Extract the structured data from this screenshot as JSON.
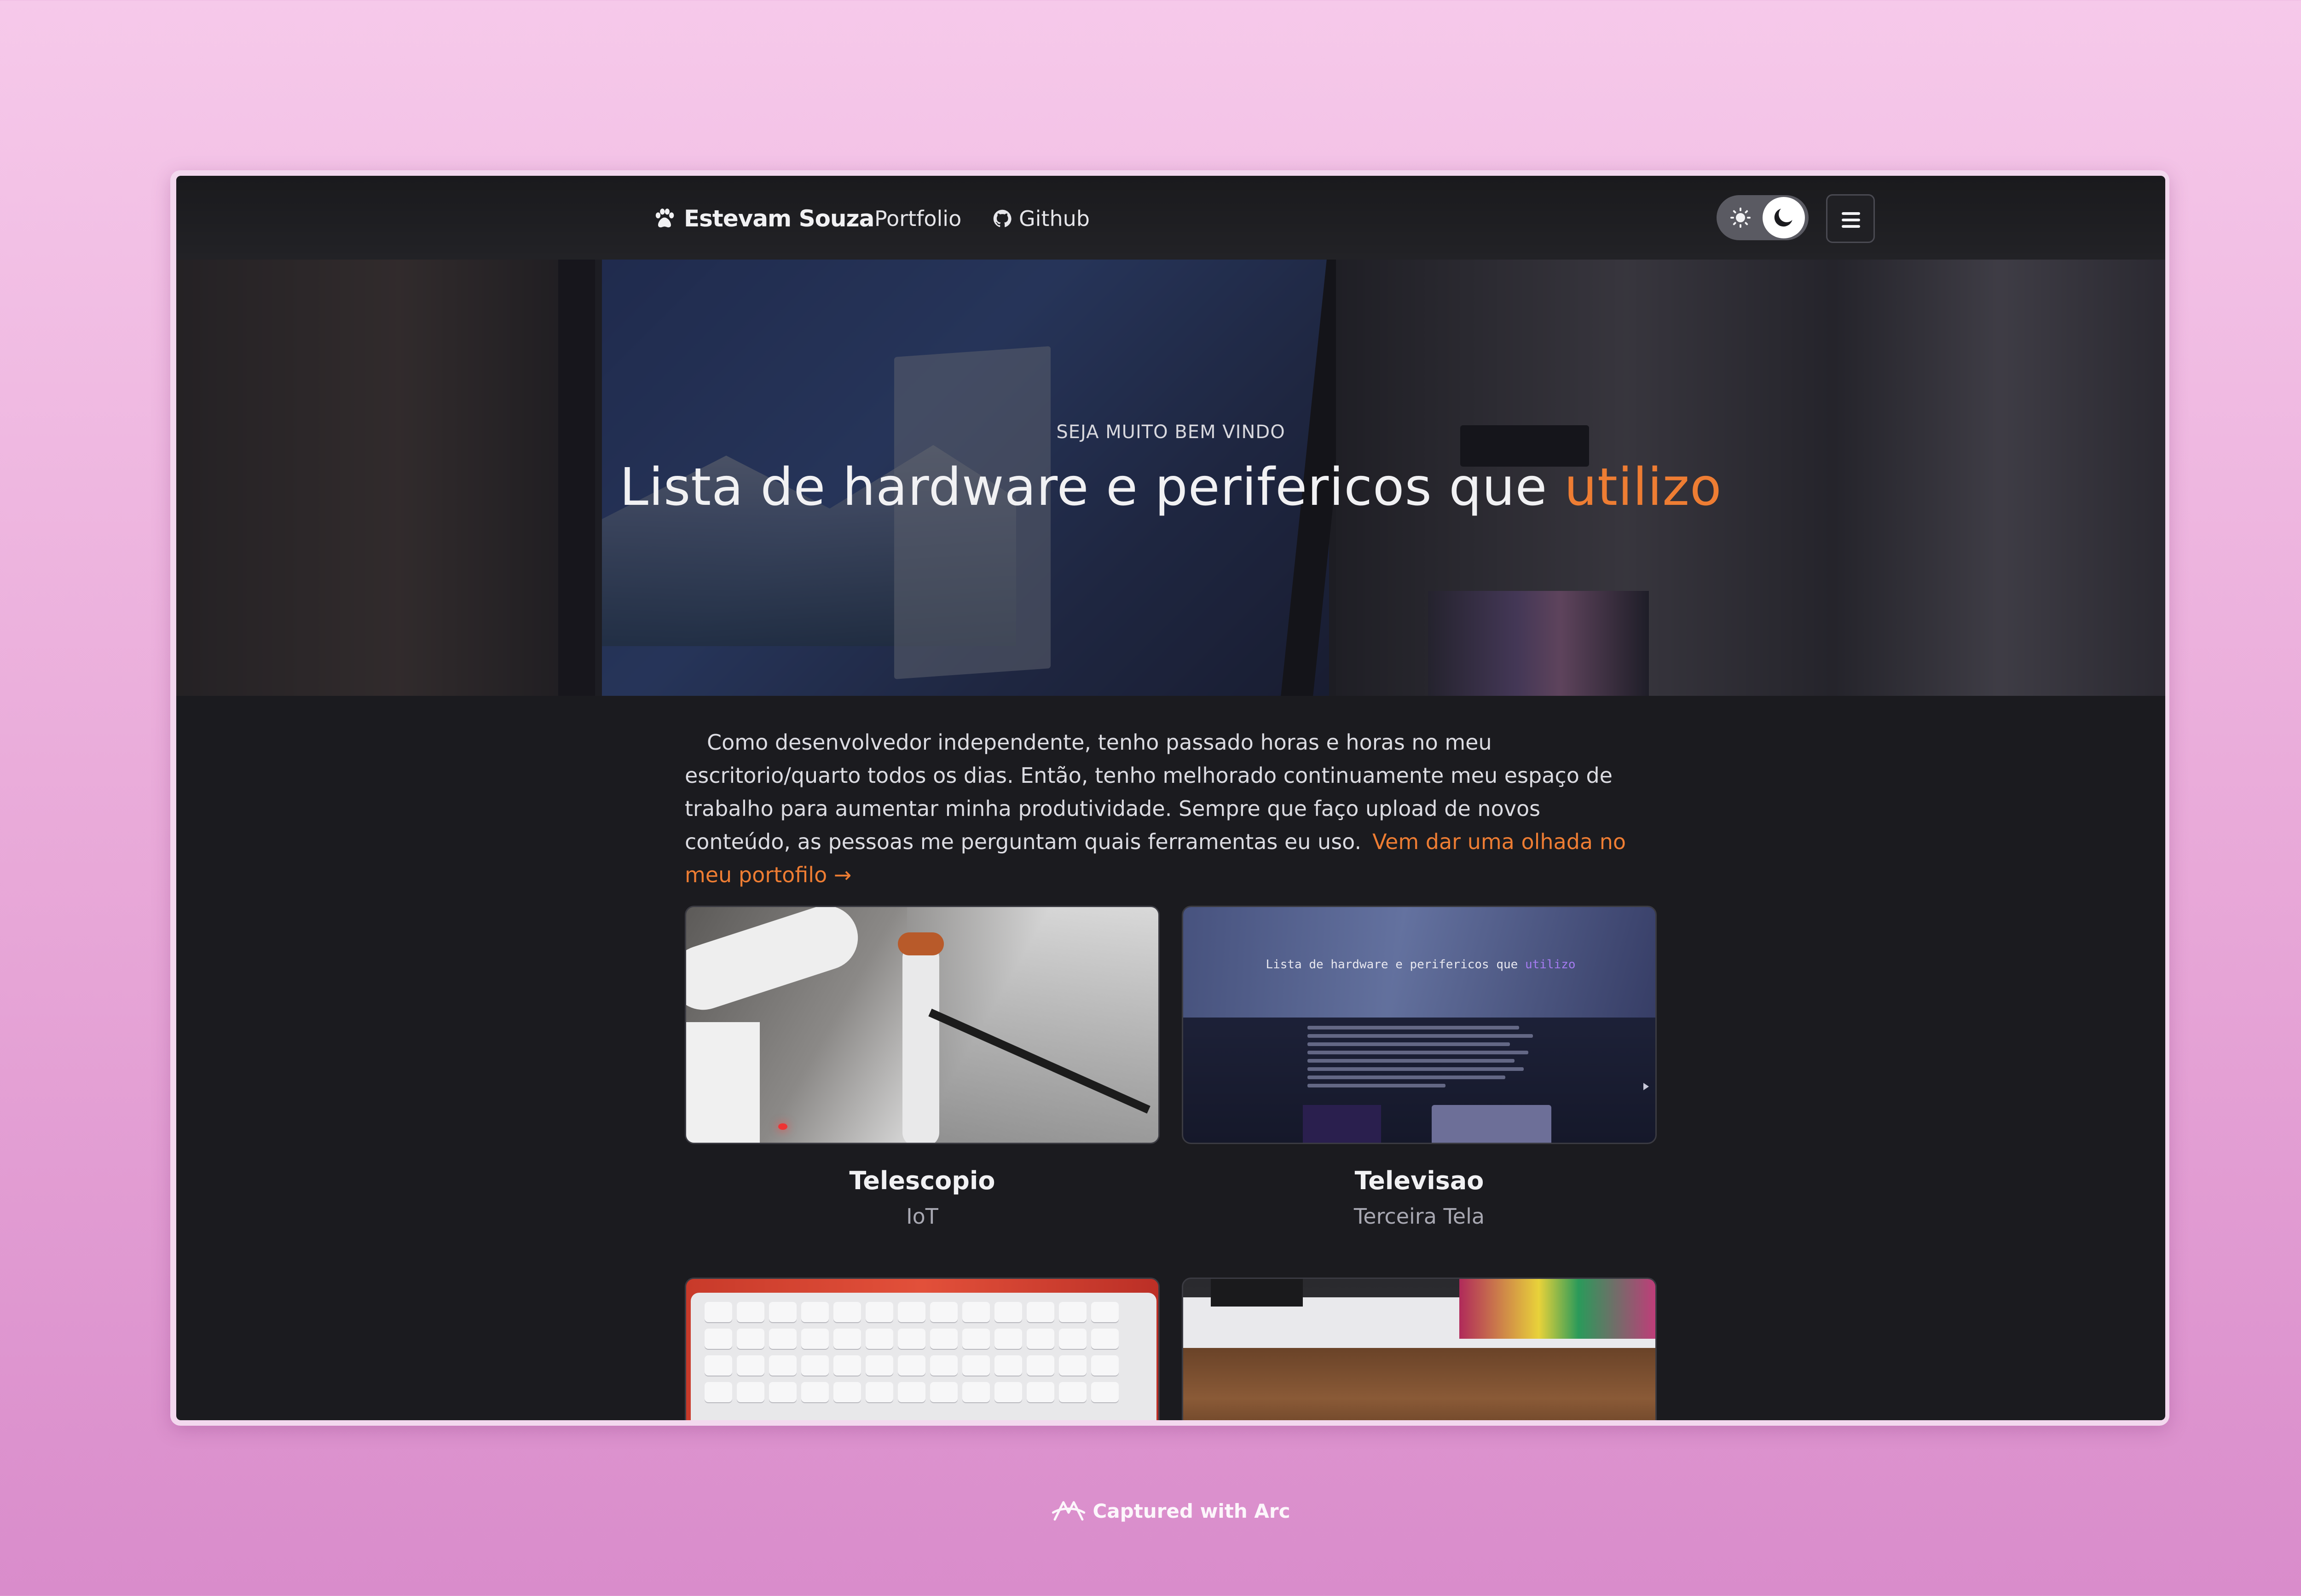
{
  "nav": {
    "brand": "Estevam Souza",
    "brand_icon": "paw-icon",
    "links": [
      {
        "label": "Portfolio"
      },
      {
        "label": "Github",
        "icon": "github-icon"
      }
    ],
    "theme_toggle": {
      "mode": "dark",
      "icons": [
        "sun-icon",
        "moon-icon"
      ]
    },
    "menu_icon": "hamburger-icon"
  },
  "hero": {
    "kicker": "SEJA MUITO BEM VINDO",
    "title_main": "Lista de hardware e perifericos que",
    "title_accent": "utilizo",
    "accent_color": "#ee7d33"
  },
  "intro": {
    "text": "Como desenvolvedor independente, tenho passado horas e horas no meu escritorio/quarto todos os dias. Então, tenho melhorado continuamente meu espaço de trabalho para aumentar minha produtividade. Sempre que faço upload de novos conteúdo, as pessoas me perguntam quais ferramentas eu uso.",
    "link": "Vem dar uma olhada no meu portofilo →"
  },
  "cards": [
    {
      "title": "Telescopio",
      "subtitle": "IoT"
    },
    {
      "title": "Televisao",
      "subtitle": "Terceira Tela"
    },
    {
      "title": "",
      "subtitle": ""
    },
    {
      "title": "",
      "subtitle": ""
    }
  ],
  "tv_screenshot_title": {
    "main": "Lista de hardware e perifericos que",
    "accent": "utilizo"
  },
  "footer": {
    "capture": "Captured with Arc"
  }
}
